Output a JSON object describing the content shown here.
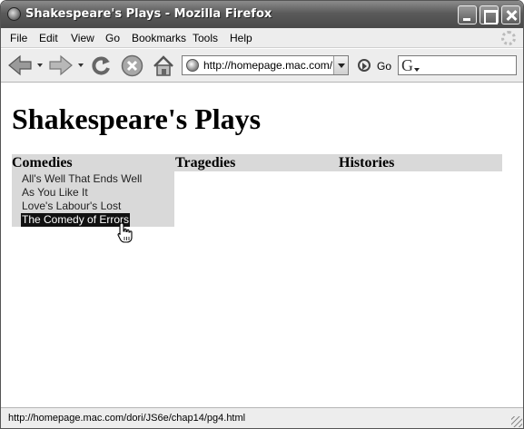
{
  "window": {
    "title": "Shakespeare's Plays - Mozilla Firefox"
  },
  "menubar": {
    "items": [
      {
        "label": "File"
      },
      {
        "label": "Edit"
      },
      {
        "label": "View"
      },
      {
        "label": "Go"
      },
      {
        "label": "Bookmarks"
      },
      {
        "label": "Tools"
      },
      {
        "label": "Help"
      }
    ]
  },
  "toolbar": {
    "icons": [
      "back-arrow-icon",
      "forward-arrow-icon",
      "reload-icon",
      "stop-icon",
      "home-icon"
    ],
    "url": "http://homepage.mac.com/dori/JS6e/chap14/pg4.html",
    "url_visible": "http://homepage.mac.com/d",
    "go_label": "Go",
    "search_engine_glyph": "G",
    "search_value": ""
  },
  "page": {
    "title": "Shakespeare's Plays",
    "nav": [
      {
        "label": "Comedies"
      },
      {
        "label": "Tragedies"
      },
      {
        "label": "Histories"
      }
    ],
    "comedies": [
      {
        "label": "All's Well That Ends Well",
        "hovered": false
      },
      {
        "label": "As You Like It",
        "hovered": false
      },
      {
        "label": "Love's Labour's Lost",
        "hovered": false
      },
      {
        "label": "The Comedy of Errors",
        "hovered": true
      }
    ],
    "colors": {
      "nav_background": "#d9d9d9",
      "hover_background": "#111111",
      "hover_text": "#ffffff"
    }
  },
  "statusbar": {
    "text": "http://homepage.mac.com/dori/JS6e/chap14/pg4.html"
  }
}
